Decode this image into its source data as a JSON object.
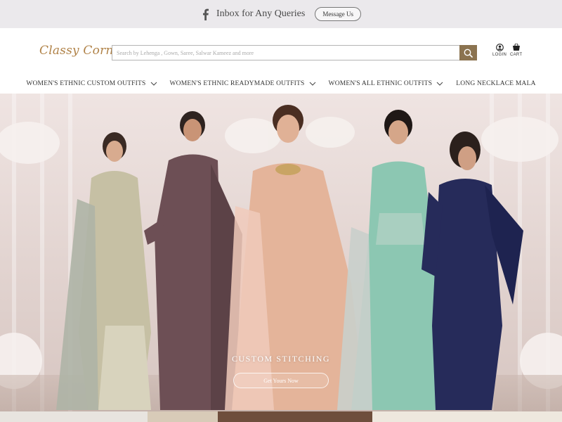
{
  "topbar": {
    "icon": "facebook-icon",
    "announcement": "Inbox for Any Queries",
    "message_button": "Message Us"
  },
  "header": {
    "logo": "Classy Corner",
    "search_placeholder": "Search by Lehenga , Gown, Saree, Salwar Kameez and more",
    "login_label": "LOGIN",
    "cart_label": "CART"
  },
  "nav": {
    "items": [
      {
        "label": "WOMEN'S ETHNIC CUSTOM OUTFITS",
        "has_dropdown": true
      },
      {
        "label": "WOMEN'S ETHNIC READYMADE OUTFITS",
        "has_dropdown": true
      },
      {
        "label": "WOMEN'S ALL ETHNIC OUTFITS",
        "has_dropdown": true
      },
      {
        "label": "LONG NECKLACE MALA",
        "has_dropdown": false
      }
    ]
  },
  "hero": {
    "title": "CUSTOM STITCHING",
    "cta": "Get Yours Now"
  },
  "colors": {
    "accent": "#8b7350",
    "logo": "#b08247",
    "topbar_bg": "#ebe9ec"
  }
}
